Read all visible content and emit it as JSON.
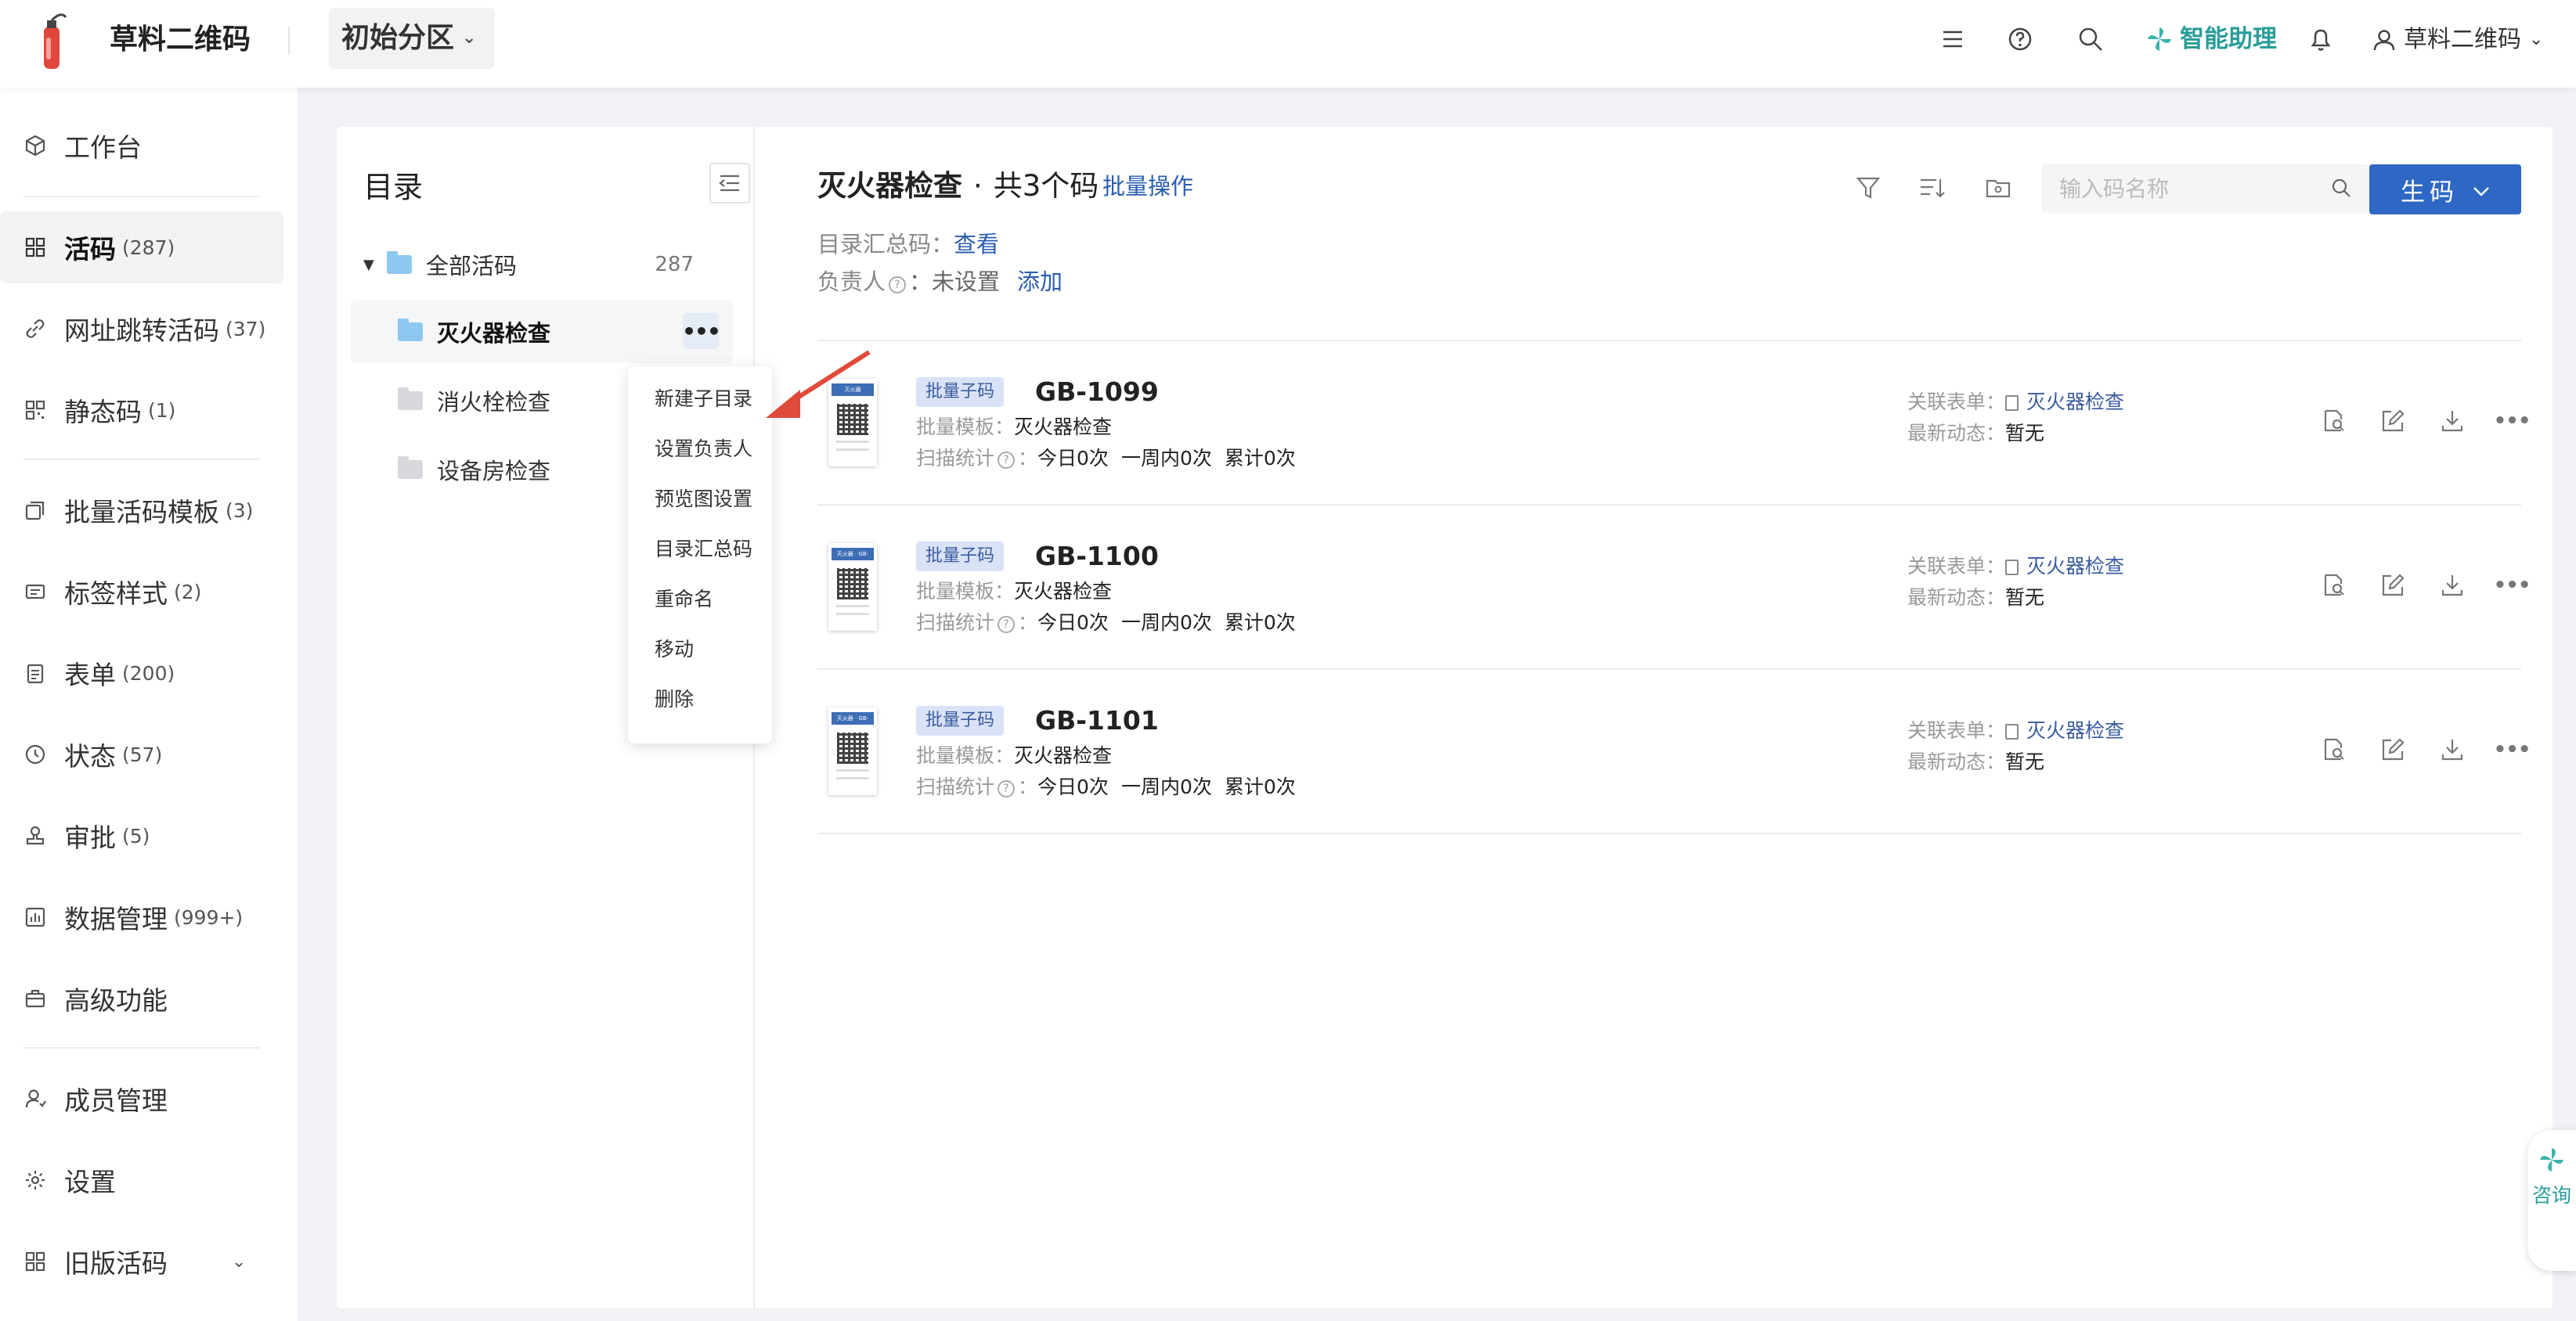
{
  "header": {
    "brand": "草料二维码",
    "partition": "初始分区",
    "assistant": "智能助理",
    "user": "草料二维码"
  },
  "sidebar": {
    "items": [
      {
        "label": "工作台",
        "count": ""
      },
      {
        "label": "活码",
        "count": "(287)"
      },
      {
        "label": "网址跳转活码",
        "count": "(37)"
      },
      {
        "label": "静态码",
        "count": "(1)"
      },
      {
        "label": "批量活码模板",
        "count": "(3)"
      },
      {
        "label": "标签样式",
        "count": "(2)"
      },
      {
        "label": "表单",
        "count": "(200)"
      },
      {
        "label": "状态",
        "count": "(57)"
      },
      {
        "label": "审批",
        "count": "(5)"
      },
      {
        "label": "数据管理",
        "count": "(999+)"
      },
      {
        "label": "高级功能",
        "count": ""
      },
      {
        "label": "成员管理",
        "count": ""
      },
      {
        "label": "设置",
        "count": ""
      },
      {
        "label": "旧版活码",
        "count": ""
      }
    ]
  },
  "tree": {
    "title": "目录",
    "root_label": "全部活码",
    "root_count": "287",
    "folders": [
      "灭火器检查",
      "消火栓检查",
      "设备房检查"
    ]
  },
  "context_menu": {
    "items": [
      "新建子目录",
      "设置负责人",
      "预览图设置",
      "目录汇总码",
      "重命名",
      "移动",
      "删除"
    ]
  },
  "list": {
    "title": "灭火器检查",
    "separator": "·",
    "total": "共3个码",
    "batch_link": "批量操作",
    "summary_label": "目录汇总码：",
    "summary_link": "查看",
    "owner_label": "负责人",
    "owner_value": "：未设置",
    "owner_link": "添加",
    "search_placeholder": "输入码名称",
    "generate_label": "生码",
    "field_labels": {
      "template": "批量模板：",
      "scan": "扫描统计",
      "scan_sep": "：",
      "form": "关联表单：",
      "activity": "最新动态："
    },
    "codes": [
      {
        "tag": "批量子码",
        "name": "GB-1099",
        "thumb_title": "灭火器",
        "template": "灭火器检查",
        "today": "今日0次",
        "week": "一周内0次",
        "total": "累计0次",
        "form": "灭火器检查",
        "activity": "暂无"
      },
      {
        "tag": "批量子码",
        "name": "GB-1100",
        "thumb_title": "灭火器 · GB-1100",
        "template": "灭火器检查",
        "today": "今日0次",
        "week": "一周内0次",
        "total": "累计0次",
        "form": "灭火器检查",
        "activity": "暂无"
      },
      {
        "tag": "批量子码",
        "name": "GB-1101",
        "thumb_title": "灭火器 · GB-1101",
        "template": "灭火器检查",
        "today": "今日0次",
        "week": "一周内0次",
        "total": "累计0次",
        "form": "灭火器检查",
        "activity": "暂无"
      }
    ]
  },
  "float_button": {
    "label": "咨询"
  },
  "colors": {
    "primary": "#2e68c4",
    "link": "#2a5db0",
    "assistant": "#2a9d9a",
    "arrow": "#e04a3a"
  }
}
